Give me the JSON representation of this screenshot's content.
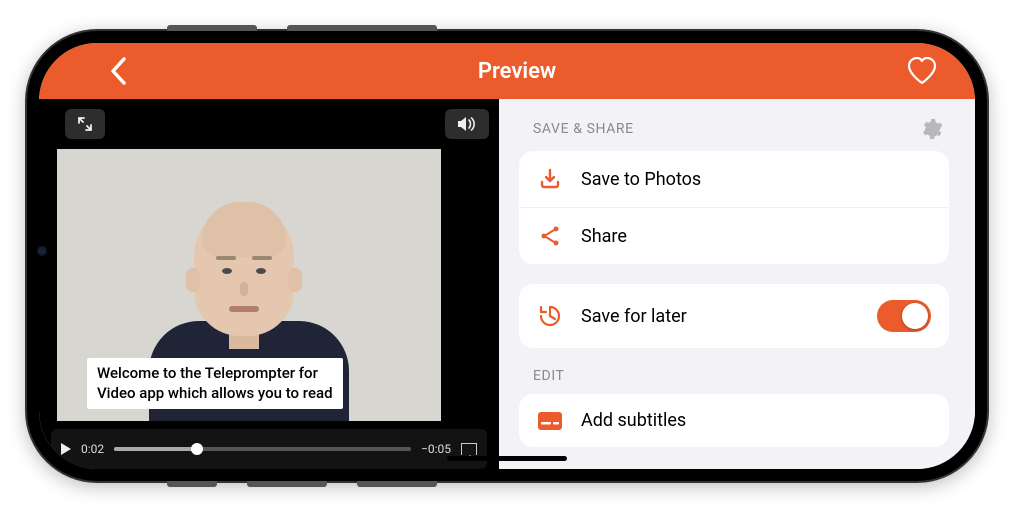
{
  "nav": {
    "title": "Preview"
  },
  "video": {
    "subtitle_line1": "Welcome to the Teleprompter for",
    "subtitle_line2": "Video app which allows you to read",
    "time_elapsed": "0:02",
    "time_remaining": "−0:05"
  },
  "sections": {
    "save_share_header": "SAVE & SHARE",
    "edit_header": "EDIT"
  },
  "rows": {
    "save_photos": "Save to Photos",
    "share": "Share",
    "save_later": "Save for later",
    "add_subtitles": "Add subtitles"
  },
  "colors": {
    "accent": "#eb5b2c"
  }
}
